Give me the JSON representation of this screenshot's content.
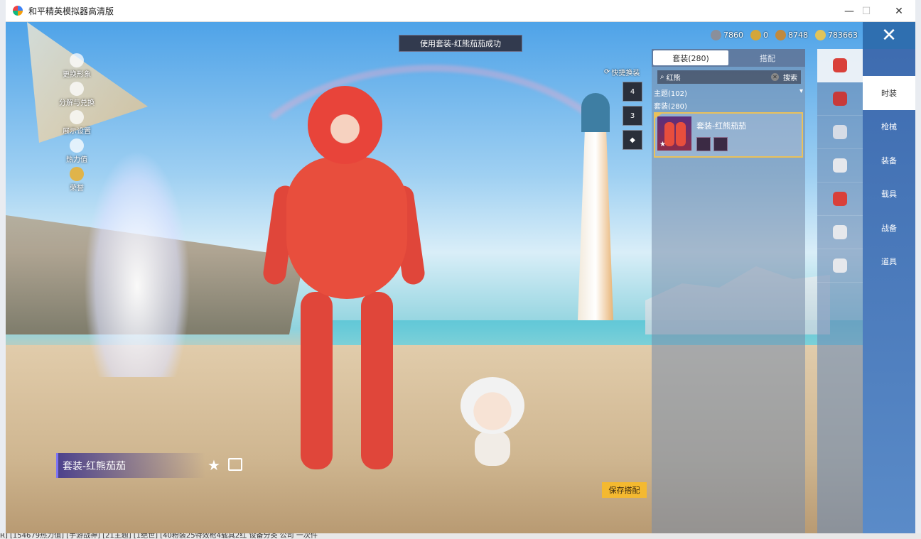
{
  "window": {
    "title": "和平精英模拟器高清版",
    "minimize": "—",
    "maximize": "☐",
    "close": "✕"
  },
  "left_menu": [
    {
      "label": "更换形象",
      "icon": "avatar-icon"
    },
    {
      "label": "分解与兑换",
      "icon": "decompose-icon"
    },
    {
      "label": "展示设置",
      "icon": "eye-icon"
    },
    {
      "label": "热力值",
      "icon": "heat-icon"
    },
    {
      "label": "荣誉",
      "icon": "honor-icon"
    }
  ],
  "toast": "使用套装-红熊茄茄成功",
  "currencies": [
    {
      "value": "7860",
      "color": "#8a8f9a"
    },
    {
      "value": "0",
      "color": "#d4a63a"
    },
    {
      "value": "8748",
      "color": "#c08a3e"
    },
    {
      "value": "783663",
      "color": "#e2c45a"
    }
  ],
  "quick_change": {
    "label": "快捷换装",
    "slots": [
      "4",
      "3",
      "◆"
    ]
  },
  "panel": {
    "tabs": [
      {
        "label": "套装(280)",
        "active": true
      },
      {
        "label": "搭配",
        "active": false
      }
    ],
    "search": {
      "value": "红熊",
      "button": "搜索"
    },
    "filter_theme": "主题(102)",
    "filter_suits": "套装(280)",
    "items": [
      {
        "title": "套装-红熊茄茄"
      }
    ]
  },
  "icon_rail": [
    {
      "icon": "suit-icon",
      "color": "#d9403a",
      "active": true
    },
    {
      "icon": "gun-icon",
      "color": "#c83a3a"
    },
    {
      "icon": "glasses-icon",
      "color": "#d6dce6"
    },
    {
      "icon": "mask-icon",
      "color": "#e6e8ec"
    },
    {
      "icon": "top-icon",
      "color": "#d9403a"
    },
    {
      "icon": "pants-icon",
      "color": "#e6e8ec"
    },
    {
      "icon": "shoes-icon",
      "color": "#e6e8ec"
    }
  ],
  "categories": [
    {
      "label": "时装",
      "active": true
    },
    {
      "label": "枪械"
    },
    {
      "label": "装备"
    },
    {
      "label": "载具"
    },
    {
      "label": "战备"
    },
    {
      "label": "道具"
    }
  ],
  "outfit_name": "套装-红熊茄茄",
  "save_button": "保存搭配",
  "taskbar_text": "R] [154679热力值] [手游战神] [21主题] [1绝世] [40粉装25特效枪4载具2红    设备分类    公司    一次件"
}
